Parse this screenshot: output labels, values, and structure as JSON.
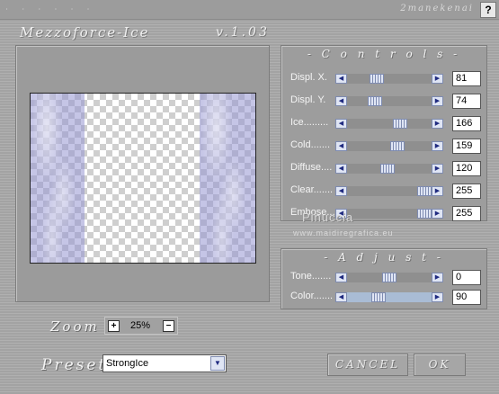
{
  "window": {
    "dots": "∙ ∙ ∙ ∙ ∙ ∙",
    "author": "2manekenai",
    "help_label": "?",
    "plugin_name": "Mezzoforce-Ice",
    "version": "v.1.03"
  },
  "controls": {
    "title": "- C o n t r o l s -",
    "items": [
      {
        "label": "Displ. X.",
        "value": "81",
        "fraction": 0.32
      },
      {
        "label": "Displ. Y.",
        "value": "74",
        "fraction": 0.29
      },
      {
        "label": "Ice.........",
        "value": "166",
        "fraction": 0.65
      },
      {
        "label": "Cold.......",
        "value": "159",
        "fraction": 0.62
      },
      {
        "label": "Diffuse....",
        "value": "120",
        "fraction": 0.47
      },
      {
        "label": "Clear.......",
        "value": "255",
        "fraction": 1.0
      },
      {
        "label": "Embose...",
        "value": "255",
        "fraction": 1.0
      }
    ]
  },
  "adjust": {
    "title": "- A d j u s t -",
    "items": [
      {
        "label": "Tone.......",
        "value": "0",
        "fraction": 0.5
      },
      {
        "label": "Color.......",
        "value": "90",
        "fraction": 0.35
      }
    ]
  },
  "watermark": {
    "name": "Pinuccia",
    "site": "www.maidiregrafica.eu"
  },
  "zoom": {
    "label": "Zoom",
    "plus": "+",
    "minus": "−",
    "value": "25%"
  },
  "preset": {
    "label": "Preset",
    "value": "StrongIce"
  },
  "buttons": {
    "cancel": "CANCEL",
    "ok": "OK"
  },
  "icons": {
    "scroll_left": "arrow-left-icon",
    "scroll_right": "arrow-right-icon",
    "dropdown": "chevron-down-icon"
  },
  "colors": {
    "ice_tint": "#9696d2",
    "accent_button": "#dfe5f4"
  }
}
